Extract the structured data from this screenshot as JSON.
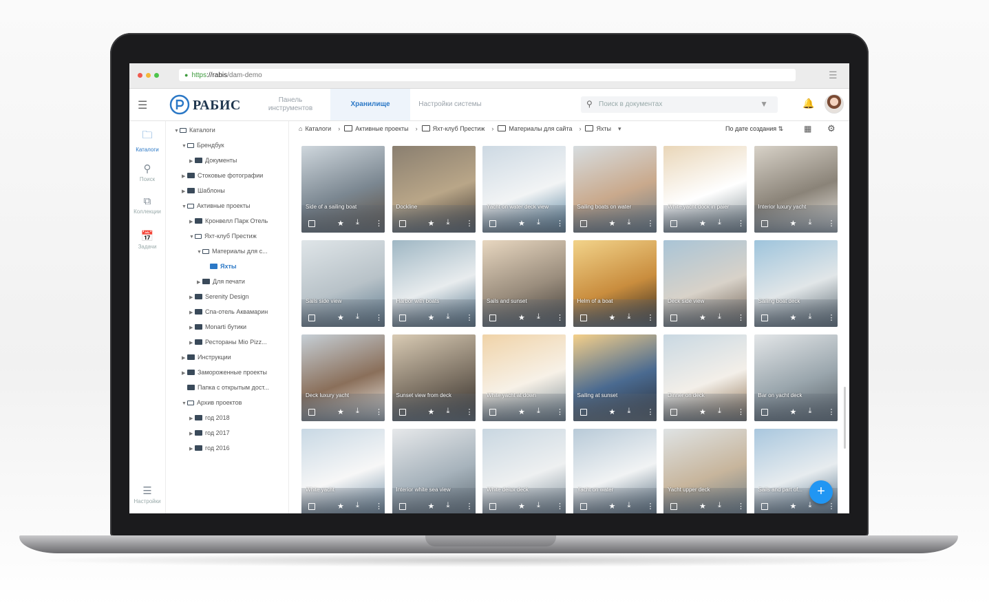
{
  "browser": {
    "url_scheme": "https",
    "url_host": "://rabis",
    "url_path": "/dam-demo"
  },
  "header": {
    "brand": "РАБИС",
    "tabs": [
      {
        "label": "Панель инструментов",
        "active": false
      },
      {
        "label": "Хранилище",
        "active": true
      },
      {
        "label": "Настройки системы",
        "active": false
      }
    ],
    "search_placeholder": "Поиск в документах",
    "accent_color": "#2b78c6"
  },
  "rail": {
    "items": [
      {
        "label": "Каталоги",
        "icon": "folder-icon",
        "active": true
      },
      {
        "label": "Поиск",
        "icon": "search-icon",
        "active": false
      },
      {
        "label": "Коллекции",
        "icon": "collections-icon",
        "active": false
      },
      {
        "label": "Задачи",
        "icon": "tasks-icon",
        "active": false
      }
    ],
    "settings_label": "Настройки"
  },
  "tree": [
    {
      "label": "Каталоги",
      "depth": 0,
      "open": true
    },
    {
      "label": "Брендбук",
      "depth": 1,
      "open": true
    },
    {
      "label": "Документы",
      "depth": 2,
      "open": false
    },
    {
      "label": "Стоковые фотографии",
      "depth": 1,
      "open": false
    },
    {
      "label": "Шаблоны",
      "depth": 1,
      "open": false
    },
    {
      "label": "Активные проекты",
      "depth": 1,
      "open": true
    },
    {
      "label": "Кронвелл Парк Отель",
      "depth": 2,
      "open": false
    },
    {
      "label": "Яхт-клуб Престиж",
      "depth": 2,
      "open": true
    },
    {
      "label": "Материалы для с...",
      "depth": 3,
      "open": true
    },
    {
      "label": "Яхты",
      "depth": 4,
      "open": false,
      "selected": true
    },
    {
      "label": "Для печати",
      "depth": 3,
      "open": false
    },
    {
      "label": "Serenity Design",
      "depth": 2,
      "open": false
    },
    {
      "label": "Спа-отель Аквамарин",
      "depth": 2,
      "open": false
    },
    {
      "label": "Monarti бутики",
      "depth": 2,
      "open": false
    },
    {
      "label": "Рестораны Mio Pizz...",
      "depth": 2,
      "open": false
    },
    {
      "label": "Инструкции",
      "depth": 1,
      "open": false
    },
    {
      "label": "Замороженные проекты",
      "depth": 1,
      "open": false
    },
    {
      "label": "Папка с открытым дост...",
      "depth": 1,
      "open": false,
      "nocaret": true
    },
    {
      "label": "Архив проектов",
      "depth": 1,
      "open": true
    },
    {
      "label": "год 2018",
      "depth": 2,
      "open": false
    },
    {
      "label": "год 2017",
      "depth": 2,
      "open": false
    },
    {
      "label": "год 2016",
      "depth": 2,
      "open": false
    }
  ],
  "breadcrumb": [
    "Каталоги",
    "Активные проекты",
    "Яхт-клуб Престиж",
    "Материалы для сайта",
    "Яхты"
  ],
  "sort_label": "По дате создания",
  "thumbnails": [
    {
      "title": "Side of a sailing boat",
      "colors": [
        "#cfd7dd",
        "#7b8791",
        "#5b4b3b"
      ]
    },
    {
      "title": "Dockline",
      "colors": [
        "#8a7f70",
        "#b9a688",
        "#3a3430"
      ]
    },
    {
      "title": "Yacht on water deck view",
      "colors": [
        "#cdd9e3",
        "#f2f4f5",
        "#4c7a98"
      ]
    },
    {
      "title": "Sailing boats on water",
      "colors": [
        "#d7dde0",
        "#c9a98c",
        "#6b7a84"
      ]
    },
    {
      "title": "White yacht dock in paier",
      "colors": [
        "#e9d6b8",
        "#ffffff",
        "#7d8a8f"
      ]
    },
    {
      "title": "Interior luxury yacht",
      "colors": [
        "#d8d2c8",
        "#8a8378",
        "#f0ede8"
      ]
    },
    {
      "title": "Sails side view",
      "colors": [
        "#dfe5e8",
        "#b8c2c8",
        "#5d7a8e"
      ]
    },
    {
      "title": "Harbor with boats",
      "colors": [
        "#9fb7c4",
        "#e8ecee",
        "#4d6f86"
      ]
    },
    {
      "title": "Sails and sunset",
      "colors": [
        "#e8d7c0",
        "#9a8d7d",
        "#3e3a36"
      ]
    },
    {
      "title": "Helm of a boat",
      "colors": [
        "#f2d38a",
        "#c98d3e",
        "#2b2622"
      ]
    },
    {
      "title": "Deck side view",
      "colors": [
        "#a9c4d6",
        "#d8d2c9",
        "#6a5c4e"
      ]
    },
    {
      "title": "Sailing boat deck",
      "colors": [
        "#9ec4dc",
        "#e1e6e8",
        "#55636c"
      ]
    },
    {
      "title": "Deck luxury yacht",
      "colors": [
        "#c6cfd6",
        "#8a6f5a",
        "#f2f0ec"
      ]
    },
    {
      "title": "Sunset view from deck",
      "colors": [
        "#d9cbb4",
        "#7f7466",
        "#2f2b28"
      ]
    },
    {
      "title": "White yacht at down",
      "colors": [
        "#f0d3a8",
        "#f7f1e7",
        "#7c8c95"
      ]
    },
    {
      "title": "Sailing at sunset",
      "colors": [
        "#f5d08a",
        "#4a6a90",
        "#2b2f38"
      ]
    },
    {
      "title": "Dinner on deck",
      "colors": [
        "#c9d8e2",
        "#f3efe9",
        "#8a6c4b"
      ]
    },
    {
      "title": "Bar on yacht deck",
      "colors": [
        "#e3e6e8",
        "#9aa6ad",
        "#545c62"
      ]
    },
    {
      "title": "White yacht",
      "colors": [
        "#c8d8e4",
        "#f7f7f7",
        "#6e8ca3"
      ]
    },
    {
      "title": "Interior white sea view",
      "colors": [
        "#e6e8ea",
        "#a7b3bc",
        "#5d6a73"
      ]
    },
    {
      "title": "White delux deck",
      "colors": [
        "#c9d7e1",
        "#eef0f1",
        "#7b8b96"
      ]
    },
    {
      "title": "Yacht on water",
      "colors": [
        "#b8cad8",
        "#f1f3f4",
        "#51687a"
      ]
    },
    {
      "title": "Yacht upper deck",
      "colors": [
        "#dfe3e4",
        "#c7b59c",
        "#6c7b84"
      ]
    },
    {
      "title": "Sails and part of...",
      "colors": [
        "#a9c7de",
        "#e7ecef",
        "#4f6d85"
      ]
    }
  ],
  "fab_label": "+"
}
